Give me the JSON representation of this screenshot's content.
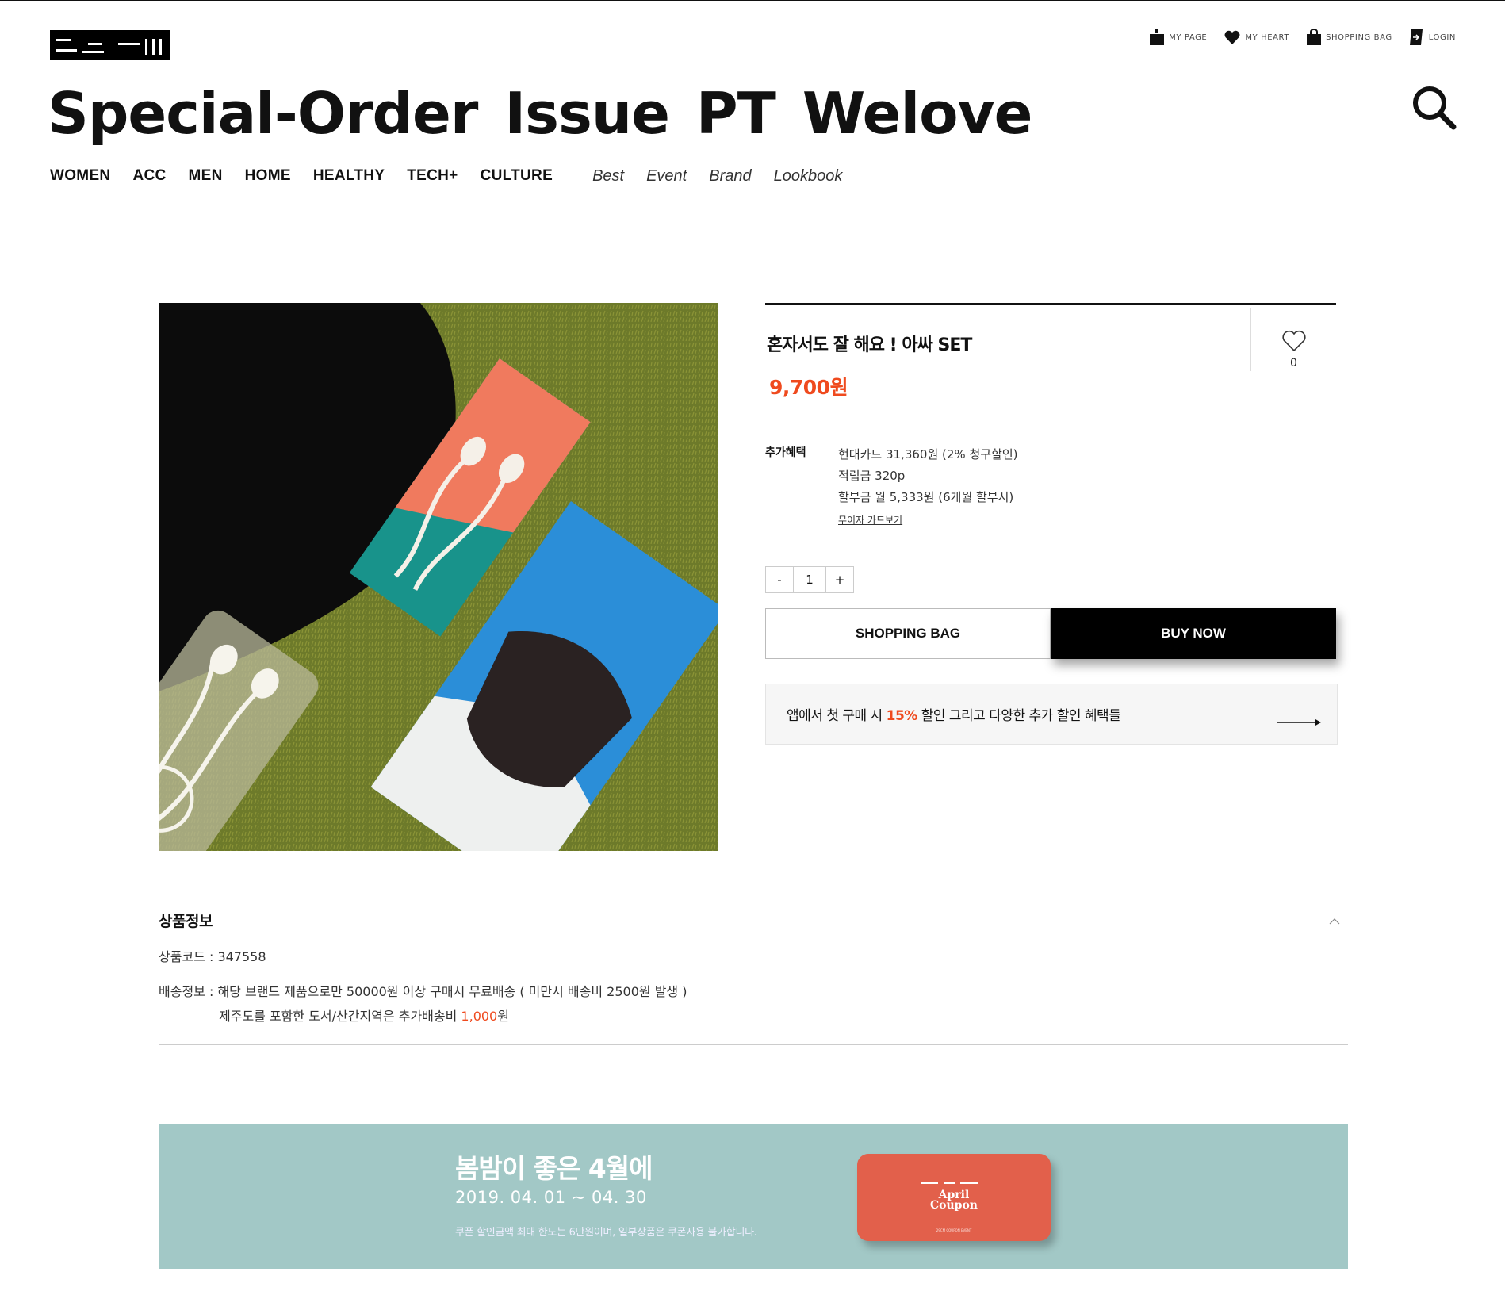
{
  "header": {
    "utility": [
      {
        "icon": "person-icon",
        "label": "MY PAGE"
      },
      {
        "icon": "heart-icon",
        "label": "MY HEART"
      },
      {
        "icon": "bag-icon",
        "label": "SHOPPING BAG"
      },
      {
        "icon": "login-icon",
        "label": "LOGIN"
      }
    ],
    "headline": [
      "Special-Order",
      "Issue",
      "PT",
      "Welove"
    ],
    "nav": {
      "categories": [
        "WOMEN",
        "ACC",
        "MEN",
        "HOME",
        "HEALTHY",
        "TECH+",
        "CULTURE"
      ],
      "sub": [
        "Best",
        "Event",
        "Brand",
        "Lookbook"
      ]
    }
  },
  "product": {
    "title": "혼자서도 잘 해요 ! 아싸 SET",
    "price": "9,700원",
    "heart_count": "0",
    "benefit_label": "추가혜택",
    "benefits": [
      "현대카드 31,360원 (2% 청구할인)",
      "적립금 320p",
      "할부금 월 5,333원 (6개월 할부시)"
    ],
    "card_link": "무이자 카드보기",
    "quantity": {
      "minus": "-",
      "value": "1",
      "plus": "+"
    },
    "shopping_bag_label": "SHOPPING BAG",
    "buy_now_label": "BUY NOW",
    "promo": {
      "before": "앱에서 첫 구매 시 ",
      "highlight": "15%",
      "after": " 할인 그리고 다양한 추가 할인 혜택들"
    }
  },
  "product_info": {
    "title": "상품정보",
    "code": "상품코드 : 347558",
    "shipping_line1": "배송정보 : 해당 브랜드 제품으로만 50000원 이상 구매시 무료배송 ( 미만시 배송비 2500원 발생 )",
    "shipping_line2_before": "제주도를 포함한 도서/산간지역은 추가배송비 ",
    "shipping_line2_fee": "1,000",
    "shipping_line2_after": "원"
  },
  "banner": {
    "title": "봄밤이 좋은 4월에",
    "date": "2019. 04. 01 ~ 04. 30",
    "note": "쿠폰 할인금액 최대 한도는 6만원이며, 일부상품은 쿠폰사용 불가합니다.",
    "coupon_title": "April\nCoupon",
    "coupon_small": "29CM COUPON EVENT"
  },
  "colors": {
    "accent": "#ef4a1e",
    "banner_bg": "#a2c8c6",
    "coupon_bg": "#e2604b"
  }
}
